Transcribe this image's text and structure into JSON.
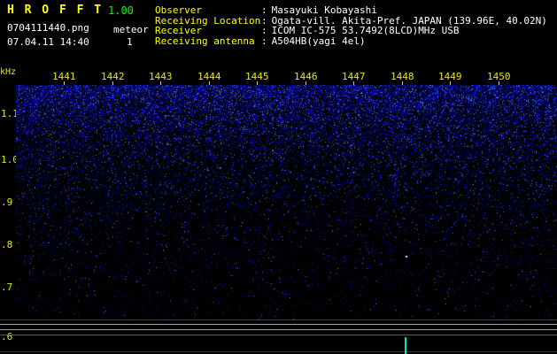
{
  "window": {
    "title": "H R O F F T",
    "version": "1.00"
  },
  "header": {
    "filename": "0704111440.png",
    "mode": "meteor",
    "datetime": "07.04.11 14:40",
    "sequence": "1",
    "info_rows": [
      {
        "label": "Observer",
        "sep": ":",
        "value": "Masayuki Kobayashi"
      },
      {
        "label": "Receiving Location",
        "sep": ":",
        "value": "Ogata-vill. Akita-Pref. JAPAN (139.96E, 40.02N)"
      },
      {
        "label": "Receiver",
        "sep": ":",
        "value": "ICOM IC-575 53.7492(8LCD)MHz USB"
      },
      {
        "label": "Receiving antenna",
        "sep": ":",
        "value": "A504HB(yagi 4el)"
      }
    ]
  },
  "spectrogram": {
    "y_axis_unit": "kHz",
    "y_ticks": [
      "1.1",
      "1.0",
      ".9",
      ".8",
      ".7",
      ".6"
    ],
    "x_ticks": [
      "1441",
      "1442",
      "1443",
      "1444",
      "1445",
      "1446",
      "1447",
      "1448",
      "1449",
      "1450"
    ]
  },
  "colors": {
    "title": "#ffff00",
    "version": "#00ff00",
    "label": "#ffff00",
    "value": "#ffffff",
    "axis": "#e8e800",
    "noise": "#0000c0",
    "spike": "#00e6c0",
    "background": "#000000"
  }
}
